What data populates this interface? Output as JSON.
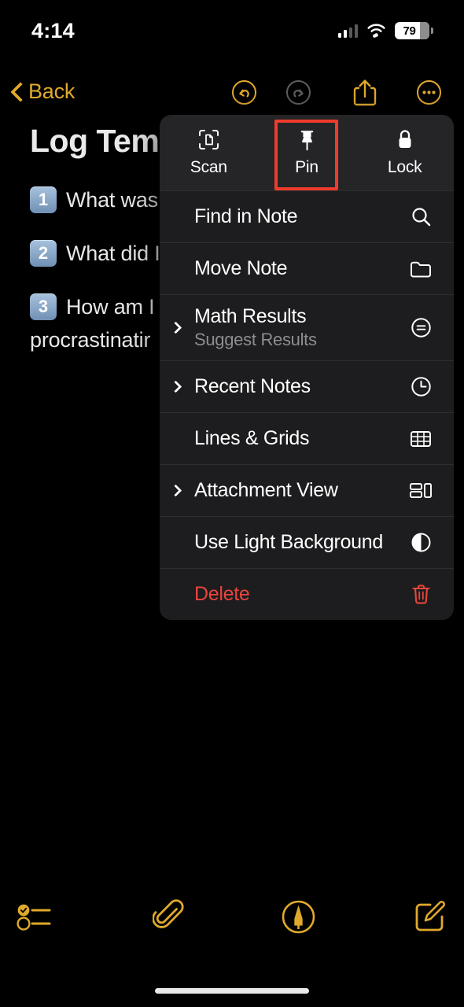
{
  "status_bar": {
    "time": "4:14",
    "battery_percent": "79",
    "cellular_icon": "cellular-bars-icon",
    "wifi_icon": "wifi-icon",
    "battery_icon": "battery-icon"
  },
  "nav_bar": {
    "back_label": "Back",
    "back_icon": "chevron-left-icon",
    "undo_icon": "undo-circle-icon",
    "redo_icon": "redo-circle-icon",
    "share_icon": "share-square-up-arrow-icon",
    "more_icon": "ellipsis-circle-icon",
    "accent_color": "#E0A92C",
    "disabled_color": "#5e5e5e"
  },
  "note": {
    "title": "Log Tem",
    "lines": [
      {
        "number": "1",
        "text": "What was"
      },
      {
        "number": "2",
        "text": "What did I"
      },
      {
        "number": "3",
        "text": "How am I f"
      }
    ],
    "wrapped_text": "procrastinatir"
  },
  "context_menu": {
    "quick_actions": [
      {
        "label": "Scan",
        "icon": "document-scanner-icon",
        "highlighted": false
      },
      {
        "label": "Pin",
        "icon": "pin-icon",
        "highlighted": true
      },
      {
        "label": "Lock",
        "icon": "lock-closed-icon",
        "highlighted": false
      }
    ],
    "highlight_color": "#ef3b2d",
    "items": [
      {
        "title": "Find in Note",
        "subtitle": "",
        "icon": "magnifier-icon",
        "submenu": false,
        "destructive": false
      },
      {
        "title": "Move Note",
        "subtitle": "",
        "icon": "folder-icon",
        "submenu": false,
        "destructive": false
      },
      {
        "title": "Math Results",
        "subtitle": "Suggest Results",
        "icon": "equals-circle-icon",
        "submenu": true,
        "destructive": false
      },
      {
        "title": "Recent Notes",
        "subtitle": "",
        "icon": "clock-icon",
        "submenu": true,
        "destructive": false
      },
      {
        "title": "Lines & Grids",
        "subtitle": "",
        "icon": "grid-table-icon",
        "submenu": false,
        "destructive": false
      },
      {
        "title": "Attachment View",
        "subtitle": "",
        "icon": "attachment-layout-icon",
        "submenu": true,
        "destructive": false
      },
      {
        "title": "Use Light Background",
        "subtitle": "",
        "icon": "contrast-circle-icon",
        "submenu": false,
        "destructive": false
      },
      {
        "title": "Delete",
        "subtitle": "",
        "icon": "trash-icon",
        "submenu": false,
        "destructive": true
      }
    ]
  },
  "bottom_toolbar": {
    "buttons": [
      {
        "icon": "checklist-icon"
      },
      {
        "icon": "paperclip-icon"
      },
      {
        "icon": "markup-pen-circle-icon"
      },
      {
        "icon": "compose-new-note-icon"
      }
    ],
    "accent_color": "#E0A92C"
  }
}
